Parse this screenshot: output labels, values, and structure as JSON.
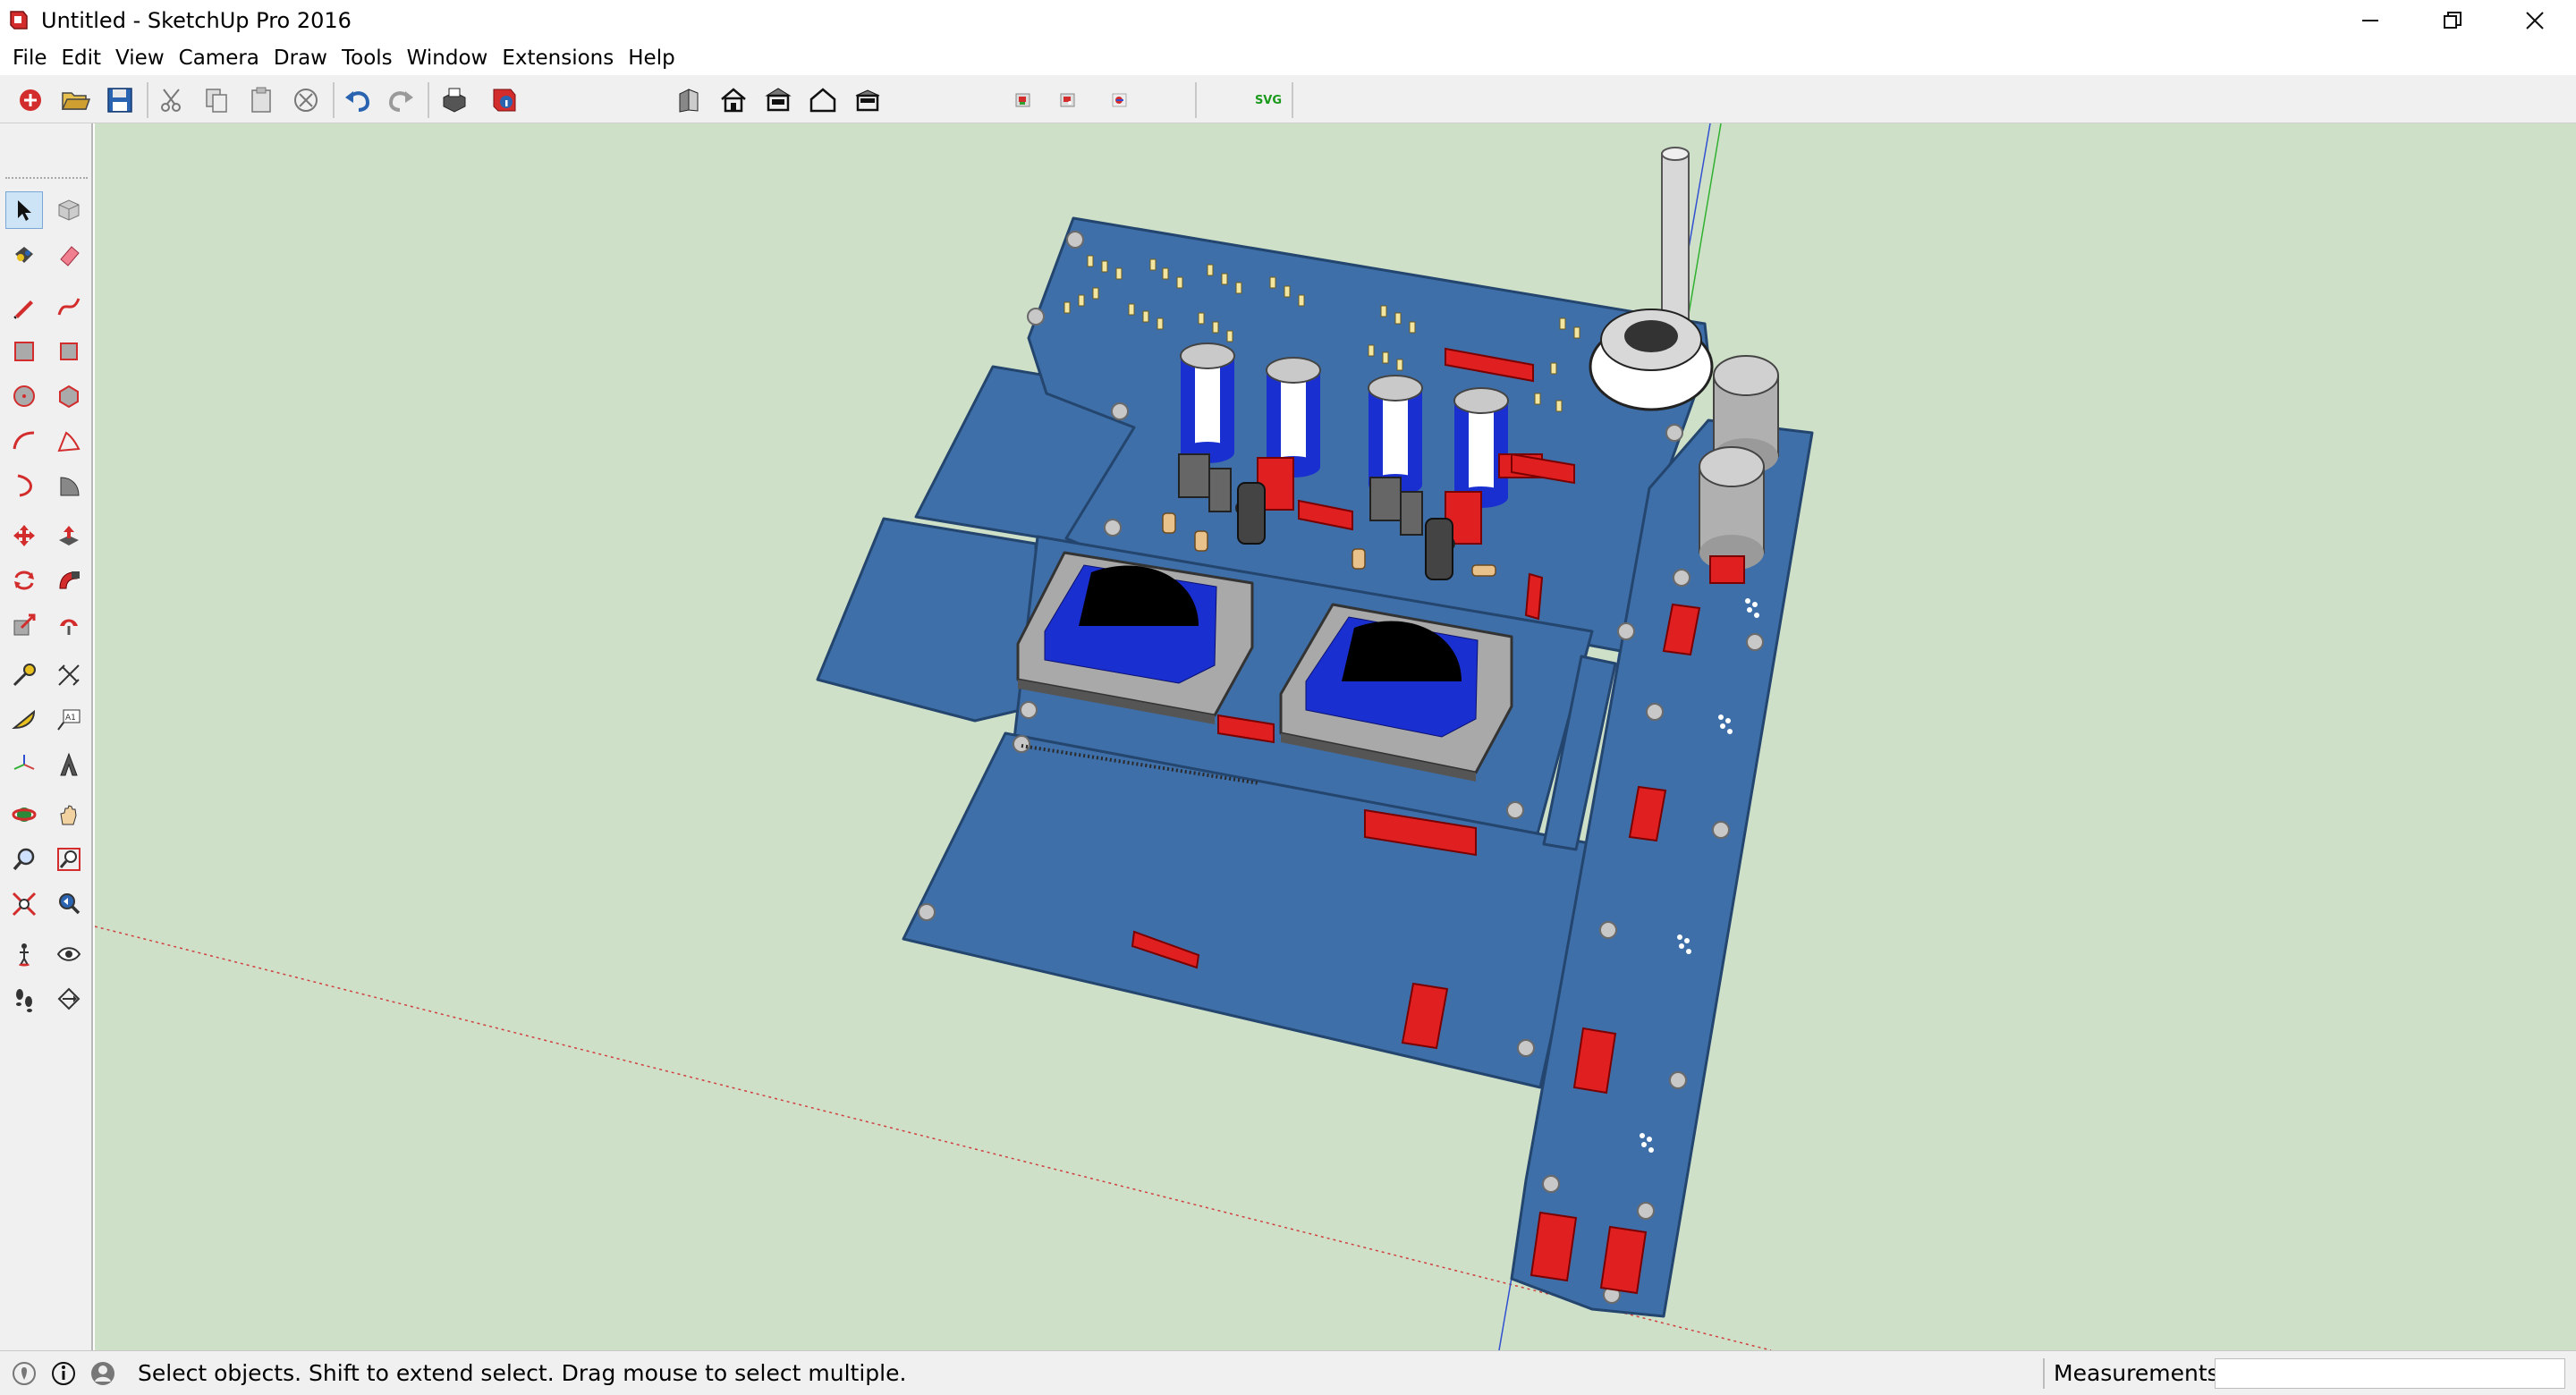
{
  "window": {
    "title": "Untitled - SketchUp Pro 2016"
  },
  "menu": [
    "File",
    "Edit",
    "View",
    "Camera",
    "Draw",
    "Tools",
    "Window",
    "Extensions",
    "Help"
  ],
  "toolbar": {
    "svg_label": "SVG"
  },
  "colors": {
    "viewport_bg": "#cfe0c8",
    "pcb_blue": "#3f6fa8",
    "pcb_edge": "#23456e",
    "capacitor_blue": "#1a2fd0",
    "connector_red": "#e02020",
    "transformer_gray": "#a9a9a9",
    "axis_red": "#d04040",
    "axis_green": "#30b030",
    "axis_blue": "#3050d0"
  },
  "status": {
    "message": "Select objects. Shift to extend select. Drag mouse to select multiple.",
    "measurements_label": "Measurements",
    "measurements_value": ""
  }
}
